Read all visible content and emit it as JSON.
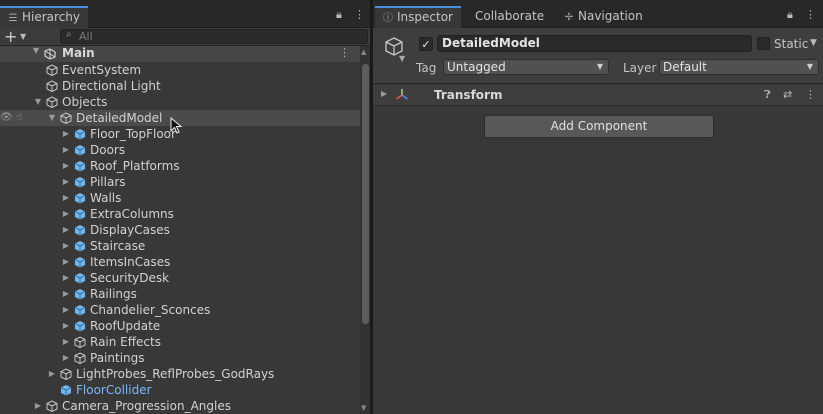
{
  "hierarchy": {
    "tab_label": "Hierarchy",
    "search_placeholder": "All",
    "scene_name": "Main",
    "items": [
      {
        "label": "EventSystem",
        "depth": 1,
        "expander": "none",
        "icon": "gameobject-outline-icon"
      },
      {
        "label": "Directional Light",
        "depth": 1,
        "expander": "none",
        "icon": "gameobject-outline-icon"
      },
      {
        "label": "Objects",
        "depth": 1,
        "expander": "expanded",
        "icon": "gameobject-outline-icon"
      },
      {
        "label": "DetailedModel",
        "depth": 2,
        "expander": "expanded",
        "icon": "gameobject-outline-icon",
        "selected": true
      },
      {
        "label": "Floor_TopFloor",
        "depth": 3,
        "expander": "collapsed",
        "icon": "prefab-icon"
      },
      {
        "label": "Doors",
        "depth": 3,
        "expander": "collapsed",
        "icon": "prefab-icon"
      },
      {
        "label": "Roof_Platforms",
        "depth": 3,
        "expander": "collapsed",
        "icon": "prefab-icon"
      },
      {
        "label": "Pillars",
        "depth": 3,
        "expander": "collapsed",
        "icon": "prefab-icon"
      },
      {
        "label": "Walls",
        "depth": 3,
        "expander": "collapsed",
        "icon": "prefab-icon"
      },
      {
        "label": "ExtraColumns",
        "depth": 3,
        "expander": "collapsed",
        "icon": "prefab-icon"
      },
      {
        "label": "DisplayCases",
        "depth": 3,
        "expander": "collapsed",
        "icon": "prefab-icon"
      },
      {
        "label": "Staircase",
        "depth": 3,
        "expander": "collapsed",
        "icon": "prefab-icon"
      },
      {
        "label": "ItemsInCases",
        "depth": 3,
        "expander": "collapsed",
        "icon": "prefab-icon"
      },
      {
        "label": "SecurityDesk",
        "depth": 3,
        "expander": "collapsed",
        "icon": "prefab-icon"
      },
      {
        "label": "Railings",
        "depth": 3,
        "expander": "collapsed",
        "icon": "prefab-icon"
      },
      {
        "label": "Chandelier_Sconces",
        "depth": 3,
        "expander": "collapsed",
        "icon": "prefab-icon"
      },
      {
        "label": "RoofUpdate",
        "depth": 3,
        "expander": "collapsed",
        "icon": "prefab-icon"
      },
      {
        "label": "Rain Effects",
        "depth": 3,
        "expander": "collapsed",
        "icon": "gameobject-outline-icon"
      },
      {
        "label": "Paintings",
        "depth": 3,
        "expander": "collapsed",
        "icon": "gameobject-outline-icon"
      },
      {
        "label": "LightProbes_ReflProbes_GodRays",
        "depth": 2,
        "expander": "collapsed",
        "icon": "gameobject-outline-icon"
      },
      {
        "label": "FloorCollider",
        "depth": 2,
        "expander": "none",
        "icon": "prefab-icon",
        "highlight": true
      },
      {
        "label": "Camera_Progression_Angles",
        "depth": 1,
        "expander": "collapsed",
        "icon": "gameobject-outline-icon"
      }
    ]
  },
  "inspector": {
    "tabs": [
      {
        "label": "Inspector",
        "icon": "info-icon",
        "active": true
      },
      {
        "label": "Collaborate",
        "icon": "",
        "active": false
      },
      {
        "label": "Navigation",
        "icon": "navigation-icon",
        "active": false
      }
    ],
    "object_name": "DetailedModel",
    "active_checked": true,
    "static_label": "Static",
    "static_checked": false,
    "tag_label": "Tag",
    "tag_value": "Untagged",
    "layer_label": "Layer",
    "layer_value": "Default",
    "component_name": "Transform",
    "add_component_label": "Add Component"
  },
  "colors": {
    "accent": "#4a8fe0",
    "prefab_blue": "#6fb7f0",
    "highlight_text": "#7cb6ff"
  }
}
